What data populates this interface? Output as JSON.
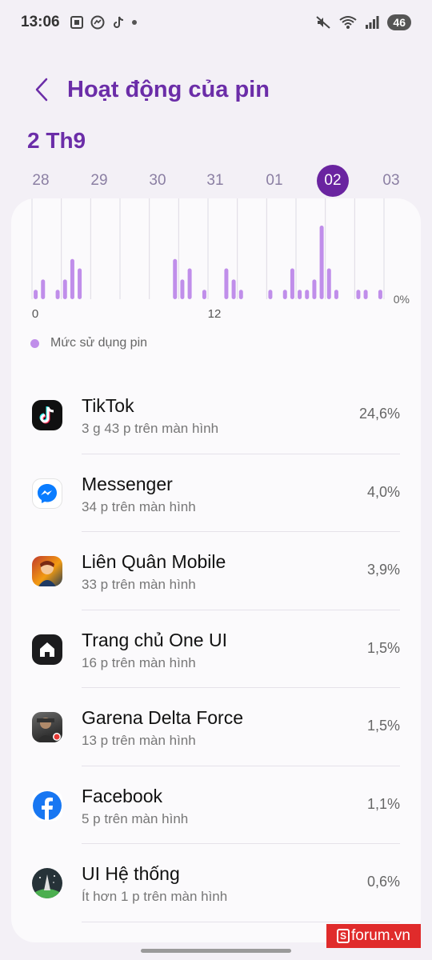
{
  "status_bar": {
    "time": "13:06",
    "battery": "46"
  },
  "header": {
    "title": "Hoạt động của pin"
  },
  "date_label": "2 Th9",
  "days": [
    "28",
    "29",
    "30",
    "31",
    "01",
    "02",
    "03"
  ],
  "selected_day": "02",
  "legend_label": "Mức sử dụng pin",
  "chart_data": {
    "type": "bar",
    "x_tick_labels": [
      "0",
      "12"
    ],
    "y_tick_labels": [
      "0%"
    ],
    "series": [
      {
        "name": "Mức sử dụng pin",
        "color": "#c08eea",
        "values": [
          1.1,
          2.3,
          0,
          1.1,
          2.3,
          4.7,
          3.6,
          0,
          0,
          0,
          0,
          0,
          0,
          0,
          0,
          0,
          0,
          0,
          0,
          4.7,
          2.3,
          3.6,
          0,
          1.1,
          0,
          0,
          3.6,
          2.3,
          1.1,
          0,
          0,
          0,
          1.1,
          0,
          1.1,
          3.6,
          1.1,
          1.1,
          2.3,
          8.6,
          3.6,
          1.1,
          0,
          0,
          1.1,
          1.1,
          0,
          1.1
        ]
      }
    ]
  },
  "apps": [
    {
      "name": "TikTok",
      "sub": "3 g 43 p trên màn hình",
      "pct": "24,6%",
      "icon": "tiktok-icon"
    },
    {
      "name": "Messenger",
      "sub": "34 p trên màn hình",
      "pct": "4,0%",
      "icon": "messenger-icon"
    },
    {
      "name": "Liên Quân Mobile",
      "sub": "33 p trên màn hình",
      "pct": "3,9%",
      "icon": "lien-quan-icon"
    },
    {
      "name": "Trang chủ One UI",
      "sub": "16 p trên màn hình",
      "pct": "1,5%",
      "icon": "home-icon"
    },
    {
      "name": "Garena Delta Force",
      "sub": "13 p trên màn hình",
      "pct": "1,5%",
      "icon": "delta-force-icon"
    },
    {
      "name": "Facebook",
      "sub": "5 p trên màn hình",
      "pct": "1,1%",
      "icon": "facebook-icon"
    },
    {
      "name": "UI Hệ thống",
      "sub": "Ít hơn 1 p trên màn hình",
      "pct": "0,6%",
      "icon": "system-ui-icon"
    }
  ],
  "watermark": "forum.vn"
}
